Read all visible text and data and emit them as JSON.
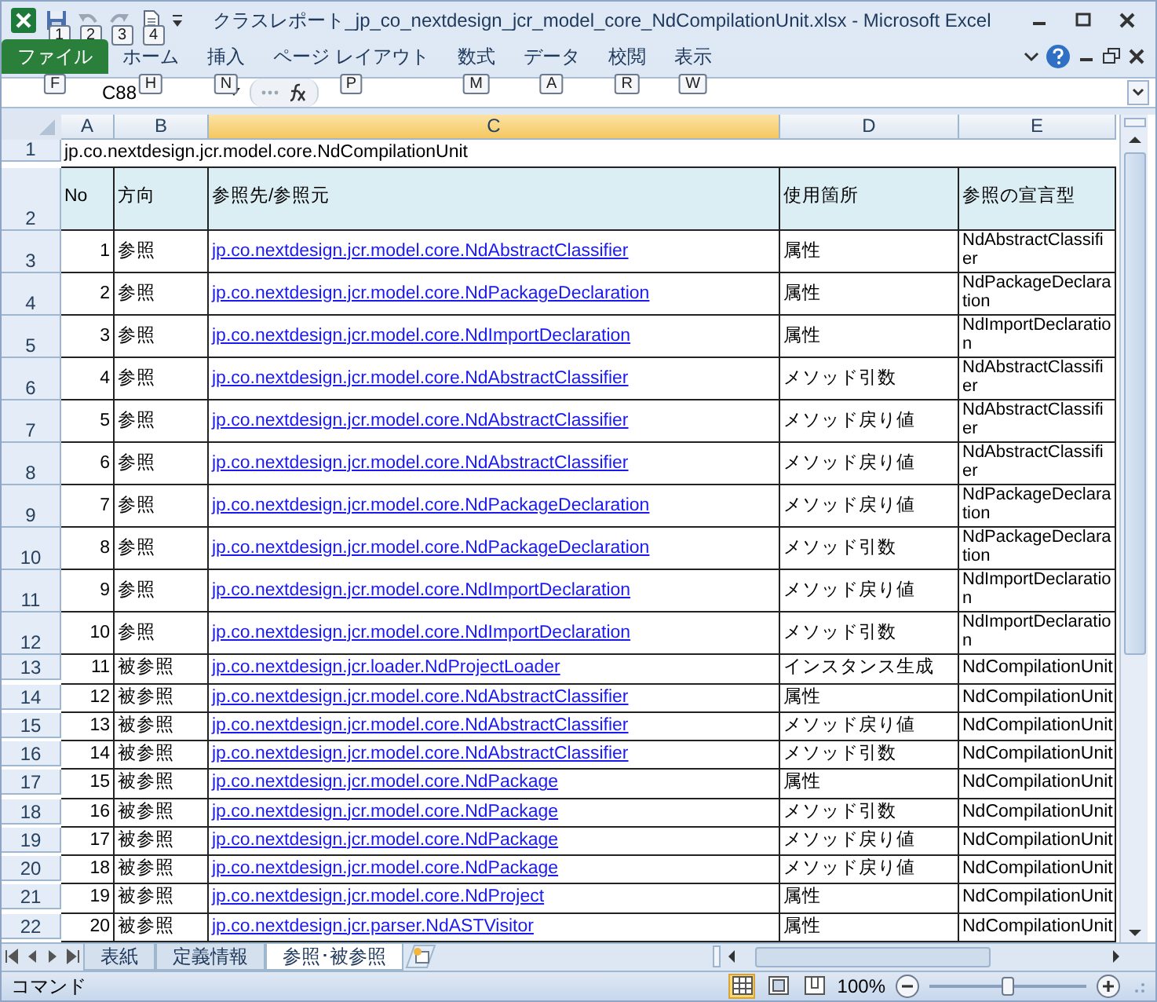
{
  "window": {
    "title": "クラスレポート_jp_co_nextdesign_jcr_model_core_NdCompilationUnit.xlsx  -  Microsoft Excel"
  },
  "quick_access": {
    "keytips": [
      "1",
      "2",
      "3",
      "4"
    ]
  },
  "ribbon_tabs": [
    {
      "label": "ファイル",
      "keytip": "F",
      "kind": "file"
    },
    {
      "label": "ホーム",
      "keytip": "H",
      "kind": "tab"
    },
    {
      "label": "挿入",
      "keytip": "N",
      "kind": "tab"
    },
    {
      "label": "ページ レイアウト",
      "keytip": "P",
      "kind": "tab"
    },
    {
      "label": "数式",
      "keytip": "M",
      "kind": "tab"
    },
    {
      "label": "データ",
      "keytip": "A",
      "kind": "tab"
    },
    {
      "label": "校閲",
      "keytip": "R",
      "kind": "tab"
    },
    {
      "label": "表示",
      "keytip": "W",
      "kind": "tab"
    }
  ],
  "formula_bar": {
    "name_box": "C88"
  },
  "columns": [
    {
      "label": "A",
      "selected": false
    },
    {
      "label": "B",
      "selected": false
    },
    {
      "label": "C",
      "selected": true
    },
    {
      "label": "D",
      "selected": false
    },
    {
      "label": "E",
      "selected": false
    }
  ],
  "title_row": {
    "header": "1",
    "text": "jp.co.nextdesign.jcr.model.core.NdCompilationUnit"
  },
  "header_row": {
    "header": "2",
    "cells": [
      "No",
      "方向",
      "参照先/参照元",
      "使用箇所",
      "参照の宣言型"
    ]
  },
  "rows": [
    {
      "header": "3",
      "no": "1",
      "direction": "参照",
      "target": "jp.co.nextdesign.jcr.model.core.NdAbstractClassifier",
      "usage": "属性",
      "decl_type": "NdAbstractClassifier",
      "kind": "wrapped"
    },
    {
      "header": "4",
      "no": "2",
      "direction": "参照",
      "target": "jp.co.nextdesign.jcr.model.core.NdPackageDeclaration",
      "usage": "属性",
      "decl_type": "NdPackageDeclaration",
      "kind": "wrapped"
    },
    {
      "header": "5",
      "no": "3",
      "direction": "参照",
      "target": "jp.co.nextdesign.jcr.model.core.NdImportDeclaration",
      "usage": "属性",
      "decl_type": "NdImportDeclaration",
      "kind": "wrapped"
    },
    {
      "header": "6",
      "no": "4",
      "direction": "参照",
      "target": "jp.co.nextdesign.jcr.model.core.NdAbstractClassifier",
      "usage": "メソッド引数",
      "decl_type": "NdAbstractClassifier",
      "kind": "wrapped"
    },
    {
      "header": "7",
      "no": "5",
      "direction": "参照",
      "target": "jp.co.nextdesign.jcr.model.core.NdAbstractClassifier",
      "usage": "メソッド戻り値",
      "decl_type": "NdAbstractClassifier",
      "kind": "wrapped"
    },
    {
      "header": "8",
      "no": "6",
      "direction": "参照",
      "target": "jp.co.nextdesign.jcr.model.core.NdAbstractClassifier",
      "usage": "メソッド戻り値",
      "decl_type": "NdAbstractClassifier",
      "kind": "wrapped"
    },
    {
      "header": "9",
      "no": "7",
      "direction": "参照",
      "target": "jp.co.nextdesign.jcr.model.core.NdPackageDeclaration",
      "usage": "メソッド戻り値",
      "decl_type": "NdPackageDeclaration",
      "kind": "wrapped"
    },
    {
      "header": "10",
      "no": "8",
      "direction": "参照",
      "target": "jp.co.nextdesign.jcr.model.core.NdPackageDeclaration",
      "usage": "メソッド引数",
      "decl_type": "NdPackageDeclaration",
      "kind": "wrapped"
    },
    {
      "header": "11",
      "no": "9",
      "direction": "参照",
      "target": "jp.co.nextdesign.jcr.model.core.NdImportDeclaration",
      "usage": "メソッド戻り値",
      "decl_type": "NdImportDeclaration",
      "kind": "wrapped"
    },
    {
      "header": "12",
      "no": "10",
      "direction": "参照",
      "target": "jp.co.nextdesign.jcr.model.core.NdImportDeclaration",
      "usage": "メソッド引数",
      "decl_type": "NdImportDeclaration",
      "kind": "wrapped"
    },
    {
      "header": "13",
      "no": "11",
      "direction": "被参照",
      "target": "jp.co.nextdesign.jcr.loader.NdProjectLoader",
      "usage": "インスタンス生成",
      "decl_type": "NdCompilationUnit",
      "kind": "single"
    },
    {
      "header": "14",
      "no": "12",
      "direction": "被参照",
      "target": "jp.co.nextdesign.jcr.model.core.NdAbstractClassifier",
      "usage": "属性",
      "decl_type": "NdCompilationUnit",
      "kind": "single"
    },
    {
      "header": "15",
      "no": "13",
      "direction": "被参照",
      "target": "jp.co.nextdesign.jcr.model.core.NdAbstractClassifier",
      "usage": "メソッド戻り値",
      "decl_type": "NdCompilationUnit",
      "kind": "single"
    },
    {
      "header": "16",
      "no": "14",
      "direction": "被参照",
      "target": "jp.co.nextdesign.jcr.model.core.NdAbstractClassifier",
      "usage": "メソッド引数",
      "decl_type": "NdCompilationUnit",
      "kind": "single"
    },
    {
      "header": "17",
      "no": "15",
      "direction": "被参照",
      "target": "jp.co.nextdesign.jcr.model.core.NdPackage",
      "usage": "属性",
      "decl_type": "NdCompilationUnit",
      "kind": "single"
    },
    {
      "header": "18",
      "no": "16",
      "direction": "被参照",
      "target": "jp.co.nextdesign.jcr.model.core.NdPackage",
      "usage": "メソッド引数",
      "decl_type": "NdCompilationUnit",
      "kind": "single"
    },
    {
      "header": "19",
      "no": "17",
      "direction": "被参照",
      "target": "jp.co.nextdesign.jcr.model.core.NdPackage",
      "usage": "メソッド戻り値",
      "decl_type": "NdCompilationUnit",
      "kind": "single"
    },
    {
      "header": "20",
      "no": "18",
      "direction": "被参照",
      "target": "jp.co.nextdesign.jcr.model.core.NdPackage",
      "usage": "メソッド戻り値",
      "decl_type": "NdCompilationUnit",
      "kind": "single"
    },
    {
      "header": "21",
      "no": "19",
      "direction": "被参照",
      "target": "jp.co.nextdesign.jcr.model.core.NdProject",
      "usage": "属性",
      "decl_type": "NdCompilationUnit",
      "kind": "single"
    },
    {
      "header": "22",
      "no": "20",
      "direction": "被参照",
      "target": "jp.co.nextdesign.jcr.parser.NdASTVisitor",
      "usage": "属性",
      "decl_type": "NdCompilationUnit",
      "kind": "single"
    }
  ],
  "sheet_tabs": [
    {
      "label": "表紙",
      "selected": false
    },
    {
      "label": "定義情報",
      "selected": false
    },
    {
      "label": "参照･被参照",
      "selected": true
    }
  ],
  "status_bar": {
    "mode": "コマンド",
    "zoom": "100%",
    "zoom_slider": {
      "level": 0.5
    }
  }
}
